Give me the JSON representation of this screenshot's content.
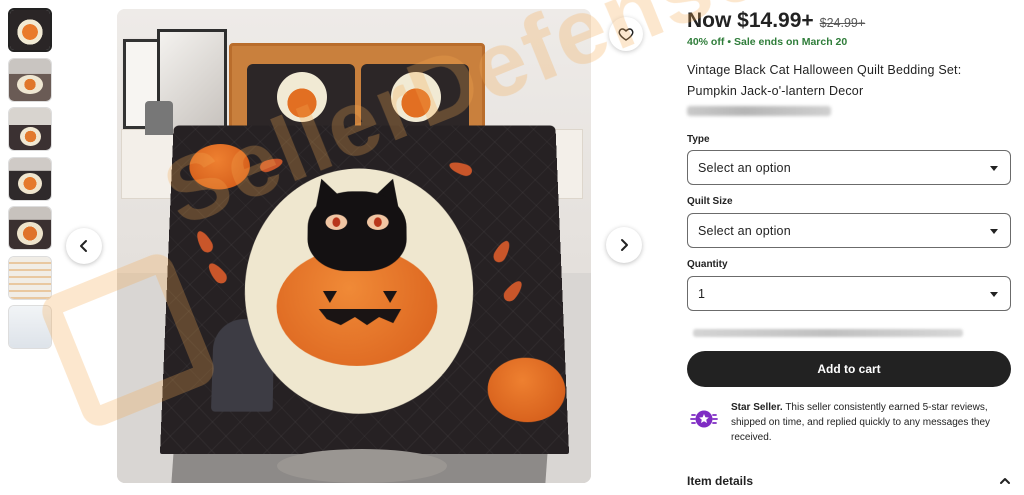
{
  "gallery": {
    "thumbnails": [
      {
        "label": "thumbnail-1",
        "active": true
      },
      {
        "label": "thumbnail-2"
      },
      {
        "label": "thumbnail-3"
      },
      {
        "label": "thumbnail-4"
      },
      {
        "label": "thumbnail-5"
      },
      {
        "label": "thumbnail-6"
      },
      {
        "label": "thumbnail-7"
      }
    ],
    "prev_icon": "chevron-left-icon",
    "next_icon": "chevron-right-icon",
    "favorite_icon": "heart-icon"
  },
  "product": {
    "price_now": "Now $14.99+",
    "price_original": "$24.99+",
    "discount": "40% off",
    "sale_ends": "Sale ends on March 20",
    "title": "Vintage Black Cat Halloween Quilt Bedding Set: Pumpkin Jack-o'-lantern Decor"
  },
  "options": {
    "type_label": "Type",
    "type_value": "Select an option",
    "quilt_size_label": "Quilt Size",
    "quilt_size_value": "Select an option",
    "quantity_label": "Quantity",
    "quantity_value": "1"
  },
  "actions": {
    "add_to_cart": "Add to cart"
  },
  "star_seller": {
    "title": "Star Seller.",
    "text": "This seller consistently earned 5-star reviews, shipped on time, and replied quickly to any messages they received.",
    "icon": "star-seller-badge-icon"
  },
  "details": {
    "label": "Item details",
    "icon": "chevron-up-icon"
  },
  "watermark": {
    "text": "SellerDefense"
  },
  "colors": {
    "price": "#222222",
    "sale_green": "#2f7d3a",
    "button_bg": "#222222",
    "star_seller_purple": "#7f2cc4",
    "watermark": "#f5aa50"
  }
}
